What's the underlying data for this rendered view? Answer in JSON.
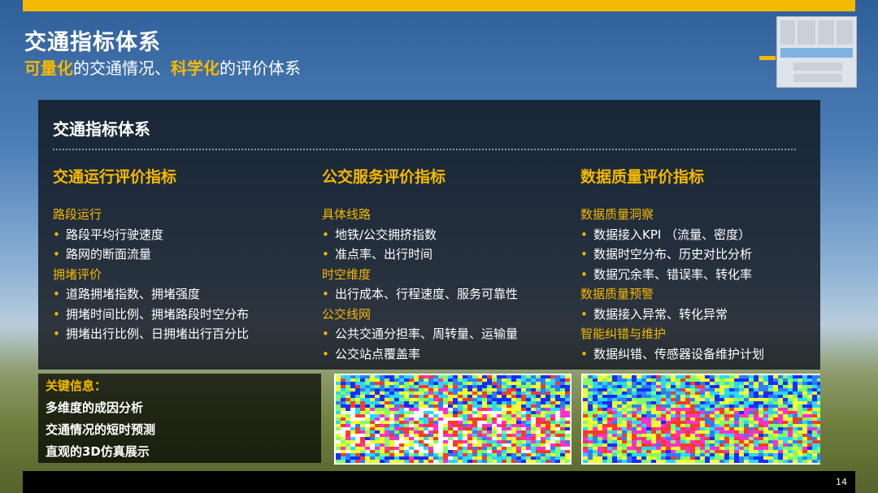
{
  "header": {
    "title": "交通指标体系",
    "subtitle_parts": [
      {
        "text": "可量化",
        "highlight": true
      },
      {
        "text": "的交通情况、",
        "highlight": false
      },
      {
        "text": "科学化",
        "highlight": true
      },
      {
        "text": "的评价体系",
        "highlight": false
      }
    ]
  },
  "panel": {
    "title": "交通指标体系",
    "columns": [
      {
        "heading": "交通运行评价指标",
        "sections": [
          {
            "name": "路段运行",
            "items": [
              "路段平均行驶速度",
              "路网的断面流量"
            ]
          },
          {
            "name": "拥堵评价",
            "items": [
              "道路拥堵指数、拥堵强度",
              "拥堵时间比例、拥堵路段时空分布",
              "拥堵出行比例、日拥堵出行百分比"
            ]
          }
        ]
      },
      {
        "heading": "公交服务评价指标",
        "sections": [
          {
            "name": "具体线路",
            "items": [
              "地铁/公交拥挤指数",
              "准点率、出行时间"
            ]
          },
          {
            "name": "时空维度",
            "items": [
              "出行成本、行程速度、服务可靠性"
            ]
          },
          {
            "name": "公交线网",
            "items": [
              "公共交通分担率、周转量、运输量",
              "公交站点覆盖率"
            ]
          }
        ]
      },
      {
        "heading": "数据质量评价指标",
        "sections": [
          {
            "name": "数据质量洞察",
            "items": [
              "数据接入KPI （流量、密度）",
              "数据时空分布、历史对比分析",
              "数据冗余率、错误率、转化率"
            ]
          },
          {
            "name": "数据质量预警",
            "items": [
              "数据接入异常、转化异常"
            ]
          },
          {
            "name": "智能纠错与维护",
            "items": [
              "数据纠错、传感器设备维护计划"
            ]
          }
        ]
      }
    ]
  },
  "key_info": {
    "title": "关键信息：",
    "items": [
      "多维度的成因分析",
      "交通情况的短时预测",
      "直观的3D仿真展示"
    ]
  },
  "heatmaps": [
    {
      "name": "heatmap-left",
      "palette": [
        "#1a2cff",
        "#2f7dff",
        "#28d8ff",
        "#7fff6a",
        "#f0ff30",
        "#ff3a2a",
        "#ff2fd0",
        "#ffffff"
      ]
    },
    {
      "name": "heatmap-right",
      "palette": [
        "#1a2cff",
        "#2f7dff",
        "#28d8ff",
        "#7fff6a",
        "#f0ff30",
        "#ff3a2a",
        "#ff2fd0"
      ]
    }
  ],
  "page_number": "14",
  "colors": {
    "accent": "#f5b800",
    "panel": "#12181f"
  }
}
